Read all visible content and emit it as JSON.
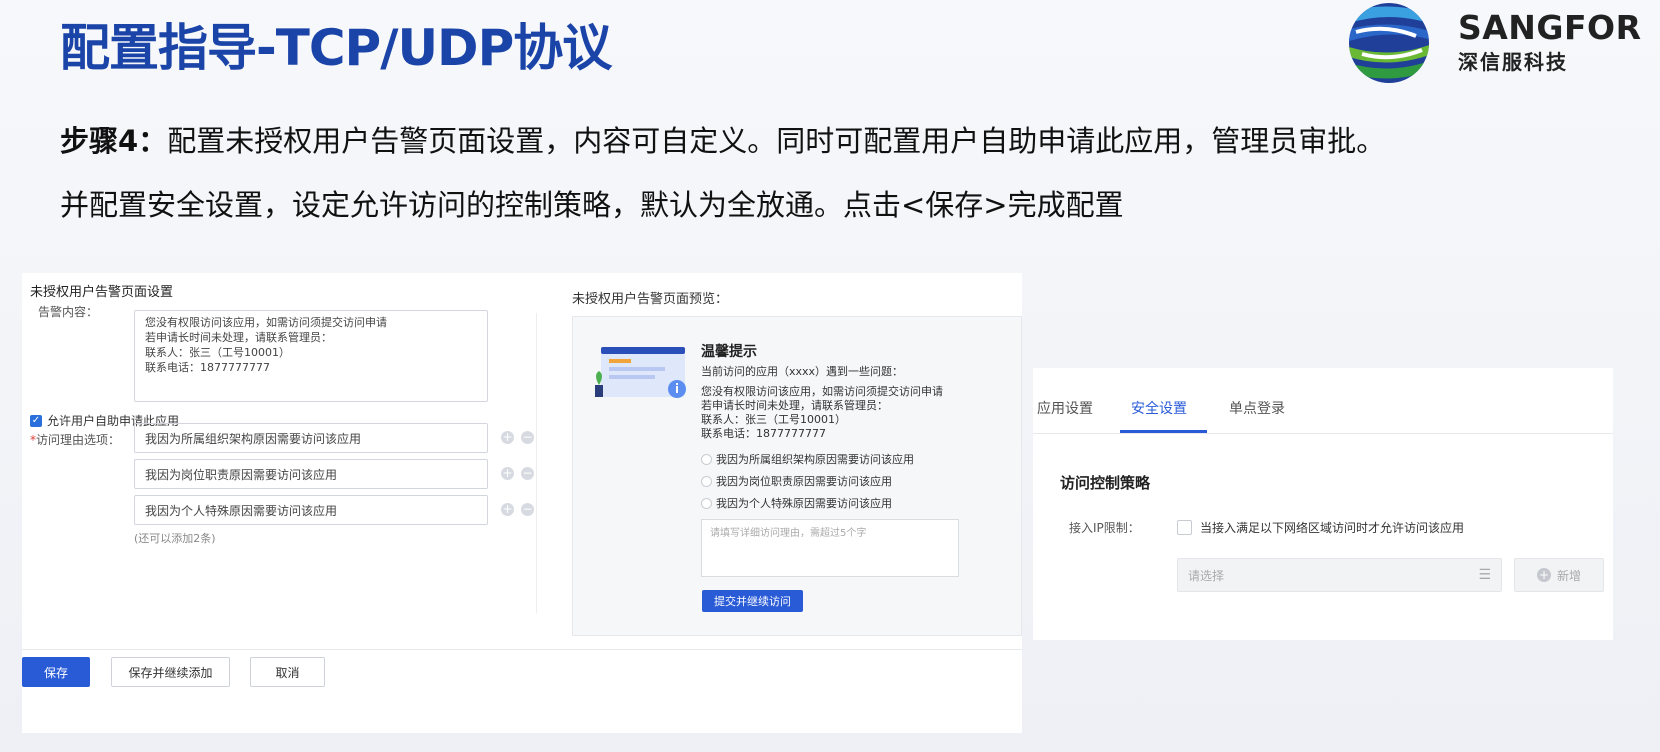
{
  "slide": {
    "title": "配置指导-TCP/UDP协议",
    "line1_bold": "步骤4：",
    "line1_rest": "配置未授权用户告警页面设置，内容可自定义。同时可配置用户自助申请此应用，管理员审批。",
    "line2": "并配置安全设置，设定允许访问的控制策略，默认为全放通。点击<保存>完成配置"
  },
  "logo": {
    "en": "SANGFOR",
    "cn": "深信服科技"
  },
  "alert_page": {
    "title": "未授权用户告警页面设置",
    "content_label": "告警内容：",
    "content_lines": [
      "您没有权限访问该应用，如需访问须提交访问申请",
      "若申请长时间未处理，请联系管理员：",
      "联系人：张三（工号10001）",
      "联系电话：1877777777"
    ],
    "self_apply_label": "允许用户自助申请此应用",
    "self_apply_checked": true,
    "reason_label": "访问理由选项：",
    "reasons": [
      "我因为所属组织架构原因需要访问该应用",
      "我因为岗位职责原因需要访问该应用",
      "我因为个人特殊原因需要访问该应用"
    ],
    "reason_hint": "(还可以添加2条)",
    "preview_label": "未授权用户告警页面预览：",
    "preview": {
      "title": "温馨提示",
      "intro": "当前访问的应用（xxxx）遇到一些问题：",
      "lines": [
        "您没有权限访问该应用，如需访问须提交访问申请",
        "若申请长时间未处理，请联系管理员：",
        "联系人：张三（工号10001）",
        "联系电话：1877777777"
      ],
      "options": [
        "我因为所属组织架构原因需要访问该应用",
        "我因为岗位职责原因需要访问该应用",
        "我因为个人特殊原因需要访问该应用"
      ],
      "textarea_placeholder": "请填写详细访问理由，需超过5个字",
      "submit_label": "提交并继续访问"
    },
    "buttons": {
      "save": "保存",
      "save_continue": "保存并继续添加",
      "cancel": "取消"
    }
  },
  "security": {
    "tabs": [
      "应用设置",
      "安全设置",
      "单点登录"
    ],
    "active_tab": "安全设置",
    "section_title": "访问控制策略",
    "ip_label": "接入IP限制：",
    "ip_checkbox_label": "当接入满足以下网络区域访问时才允许访问该应用",
    "select_placeholder": "请选择",
    "add_label": "新增"
  },
  "colors": {
    "title_blue": "#1a44a8",
    "primary": "#2a5bd7"
  }
}
